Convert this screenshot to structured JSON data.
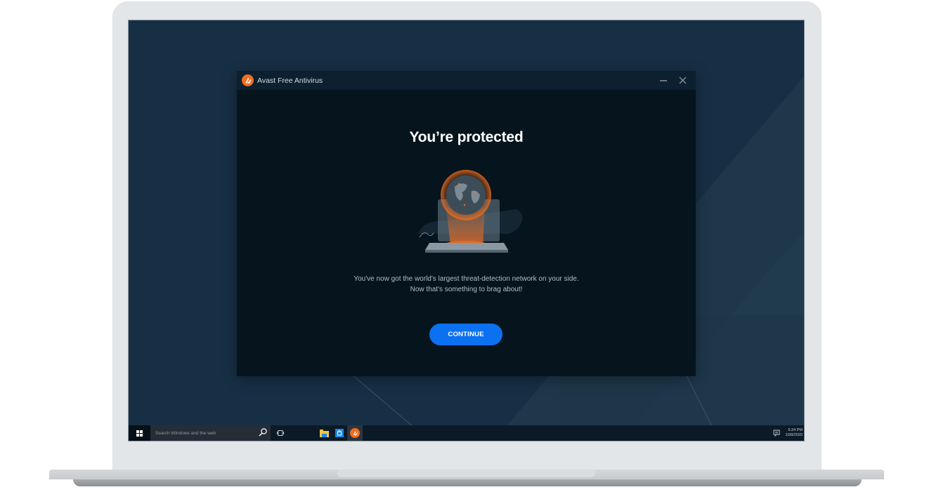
{
  "window": {
    "title": "Avast Free Antivirus",
    "minimize_icon": "minimize-icon",
    "close_icon": "close-icon",
    "logo_icon": "avast-logo-icon"
  },
  "main": {
    "headline": "You’re protected",
    "illustration": "globe-over-laptop-illustration",
    "description_line1": "You've now got the world's largest threat-detection network on your side.",
    "description_line2": "Now that's something to brag about!",
    "continue_label": "CONTINUE"
  },
  "taskbar": {
    "start_icon": "windows-start-icon",
    "search_placeholder": "Search Windows and the web",
    "search_icon": "search-icon",
    "task_view_icon": "task-view-icon",
    "apps": [
      {
        "name": "File Explorer",
        "icon": "file-explorer-icon"
      },
      {
        "name": "Store",
        "icon": "store-icon"
      },
      {
        "name": "Avast",
        "icon": "avast-icon",
        "active": true
      }
    ],
    "notification_icon": "action-center-icon",
    "time": "5:24 PM",
    "date": "10/8/2020"
  },
  "colors": {
    "accent": "#0c71f0",
    "brand_orange": "#f26c1d",
    "window_bg": "#06141d",
    "desktop_bg": "#172f44"
  }
}
